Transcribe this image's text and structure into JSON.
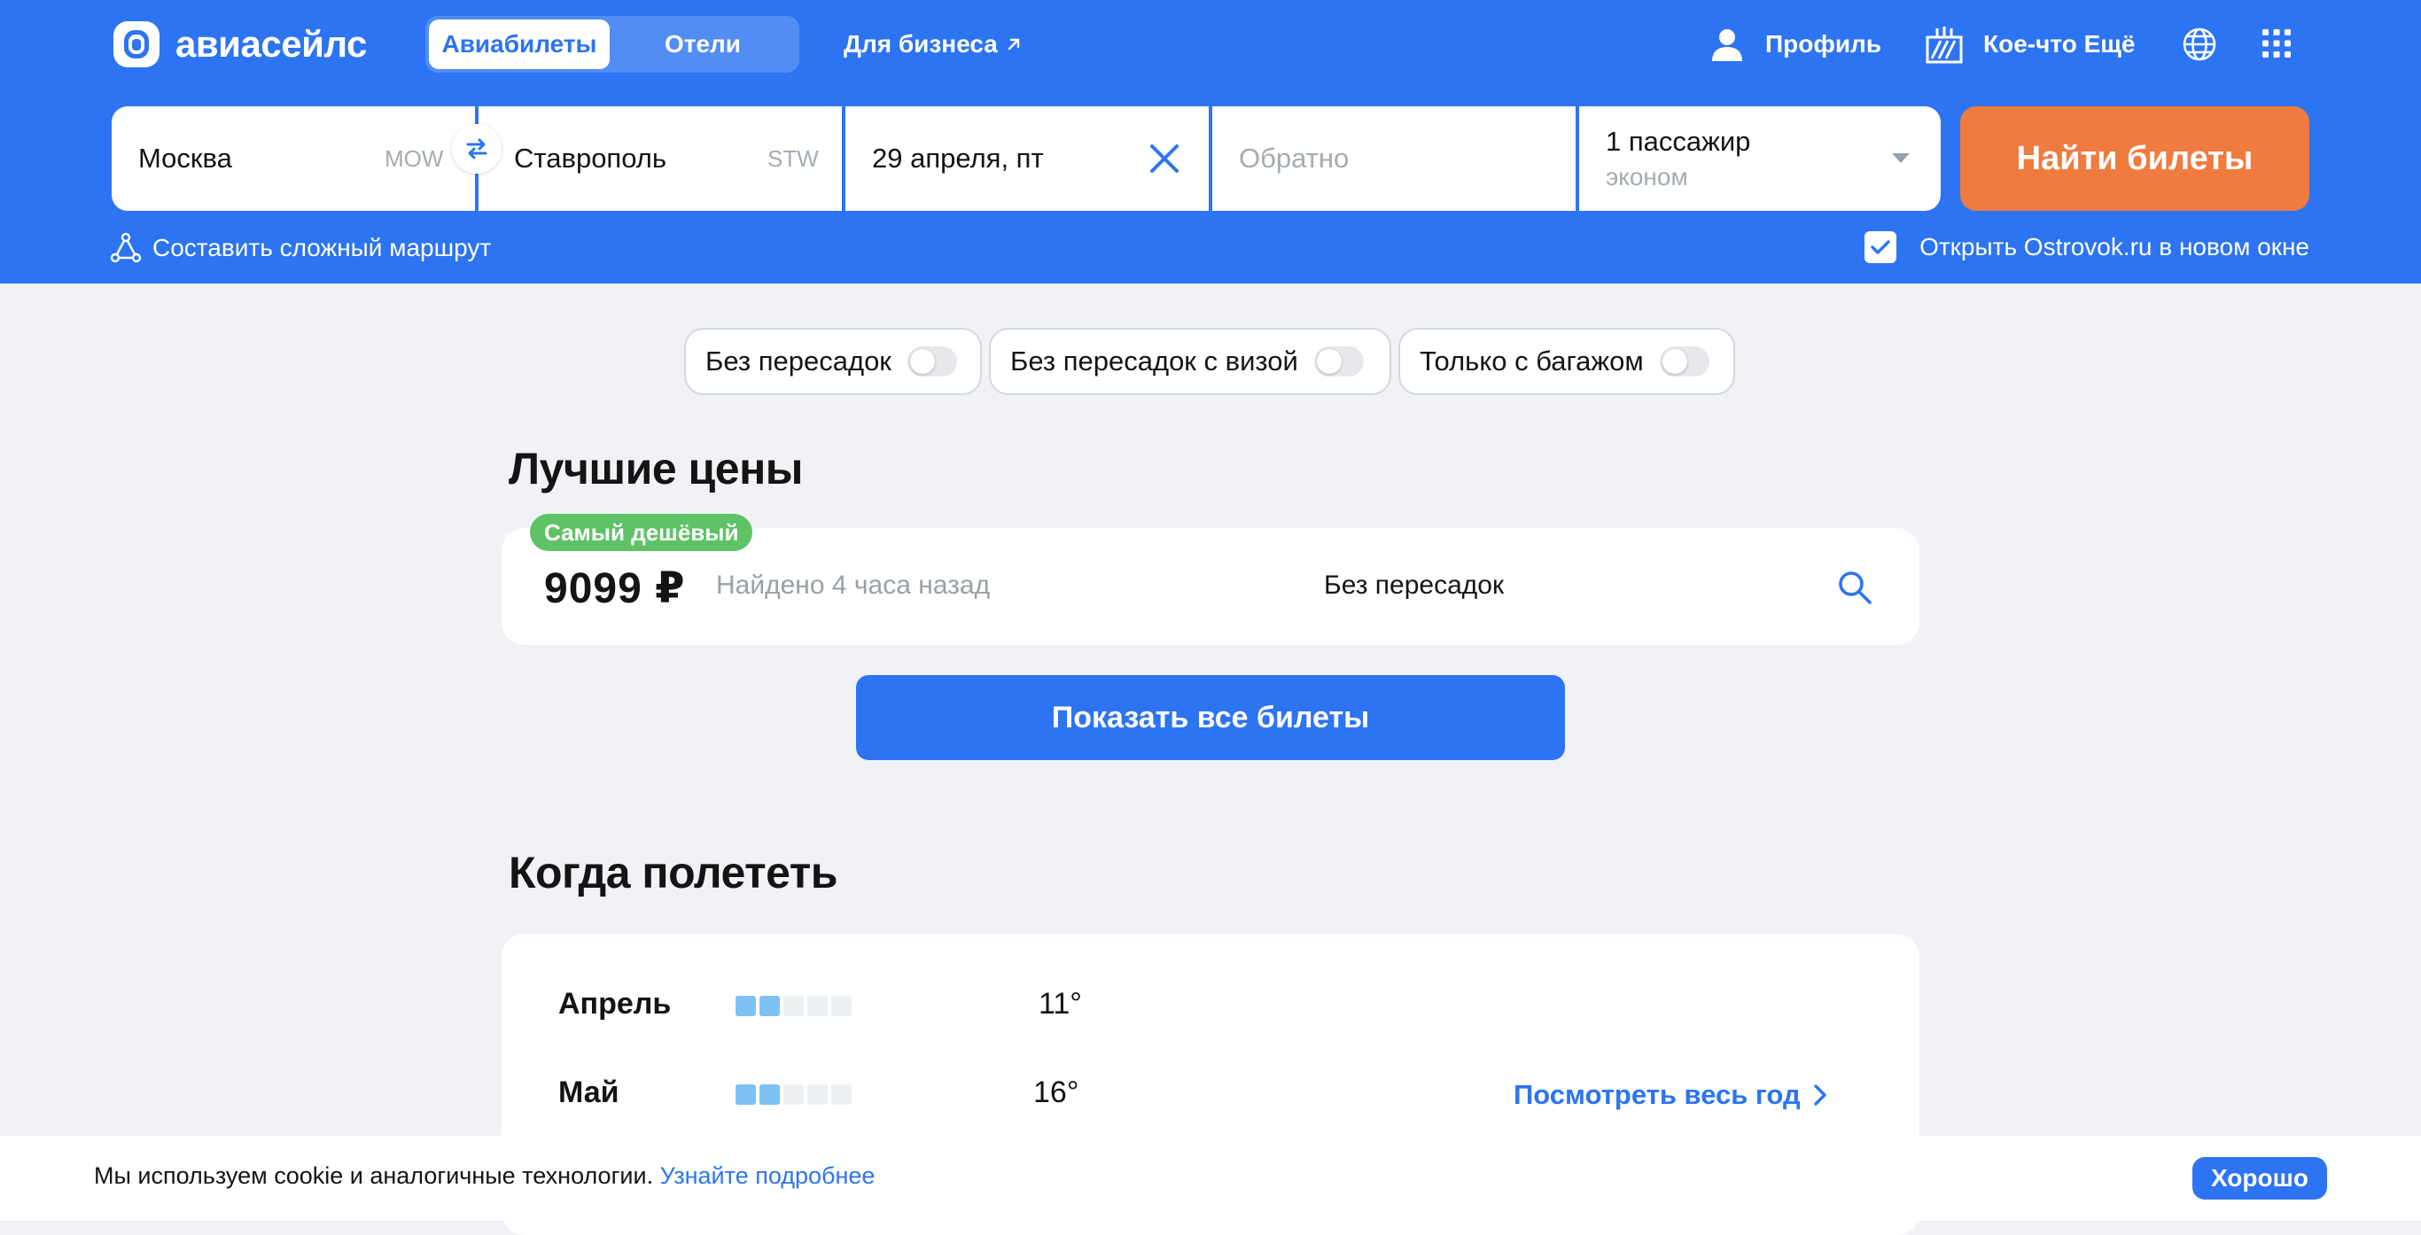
{
  "header": {
    "logo_text": "авиасейлс",
    "tabs": [
      {
        "label": "Авиабилеты",
        "active": true
      },
      {
        "label": "Отели",
        "active": false
      }
    ],
    "business_link": "Для бизнеса",
    "profile_label": "Профиль",
    "more_label": "Кое-что Ещё",
    "icons": [
      "logo-icon",
      "external-arrow-icon",
      "user-icon",
      "gift-icon",
      "globe-icon",
      "apps-grid-icon"
    ]
  },
  "search": {
    "origin": "Москва",
    "origin_code": "MOW",
    "destination": "Ставрополь",
    "destination_code": "STW",
    "depart_date": "29 апреля, пт",
    "return_placeholder": "Обратно",
    "passengers": "1 пассажир",
    "cabin_class": "эконом",
    "find_button": "Найти билеты",
    "complex_route": "Составить сложный маршрут",
    "ostrovok_label": "Открыть Ostrovok.ru в новом окне",
    "ostrovok_checked": true
  },
  "filters": [
    {
      "label": "Без пересадок",
      "on": false
    },
    {
      "label": "Без пересадок с визой",
      "on": false
    },
    {
      "label": "Только с багажом",
      "on": false
    }
  ],
  "best_prices": {
    "title": "Лучшие цены",
    "badge": "Самый дешёвый",
    "price": "9099 ₽",
    "found": "Найдено 4 часа назад",
    "stops": "Без пересадок",
    "show_all": "Показать все билеты"
  },
  "when_to_fly": {
    "title": "Когда полететь",
    "months": [
      {
        "name": "Апрель",
        "level": 2,
        "max": 5,
        "temp": "11°"
      },
      {
        "name": "Май",
        "level": 2,
        "max": 5,
        "temp": "16°"
      }
    ],
    "year_link": "Посмотреть весь год"
  },
  "cookie": {
    "text": "Мы используем cookie и аналогичные технологии.",
    "link": "Узнайте подробнее",
    "button": "Хорошо"
  },
  "colors": {
    "brand_blue": "#2d74f2",
    "accent_orange": "#f07b3f",
    "badge_green": "#5ec267",
    "background": "#f0f2f5"
  }
}
